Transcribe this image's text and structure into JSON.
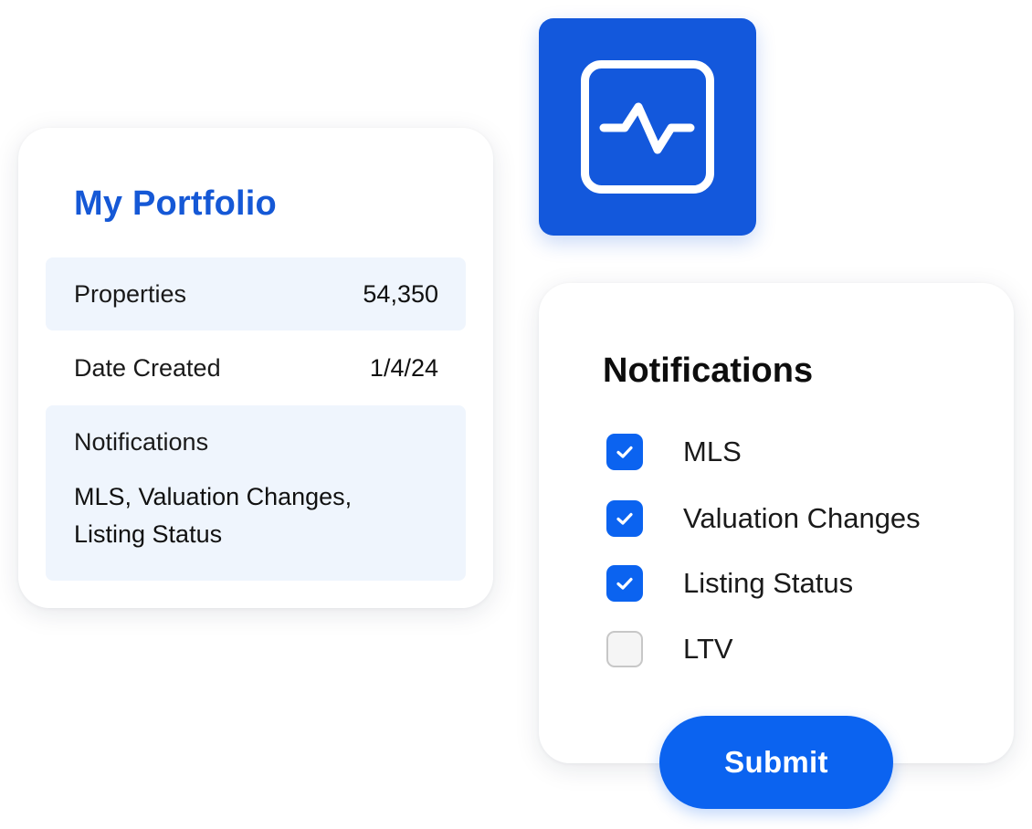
{
  "portfolio": {
    "title": "My Portfolio",
    "rows": [
      {
        "label": "Properties",
        "value": "54,350"
      },
      {
        "label": "Date Created",
        "value": "1/4/24"
      }
    ],
    "notifications": {
      "label": "Notifications",
      "value": "MLS, Valuation Changes, Listing Status"
    }
  },
  "activity_tile": {
    "icon": "activity-pulse-icon",
    "color": "#1358dc"
  },
  "notifications_panel": {
    "title": "Notifications",
    "options": [
      {
        "label": "MLS",
        "checked": true
      },
      {
        "label": "Valuation Changes",
        "checked": true
      },
      {
        "label": "Listing Status",
        "checked": true
      },
      {
        "label": "LTV",
        "checked": false
      }
    ]
  },
  "submit": {
    "label": "Submit"
  },
  "colors": {
    "accent": "#0b63f0",
    "title_blue": "#1558d6",
    "row_background": "#eff5fd"
  }
}
